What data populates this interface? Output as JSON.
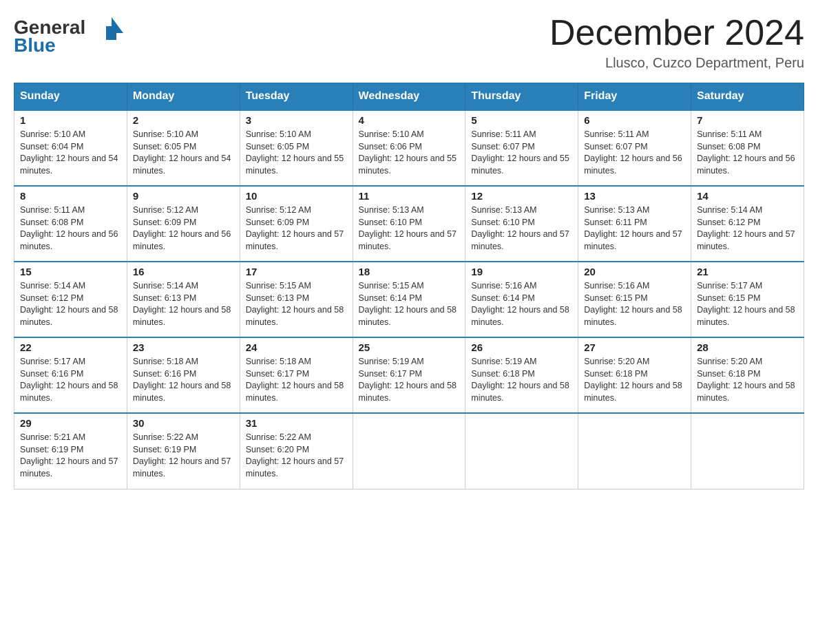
{
  "header": {
    "logo_general": "General",
    "logo_blue": "Blue",
    "title": "December 2024",
    "subtitle": "Llusco, Cuzco Department, Peru"
  },
  "days_of_week": [
    "Sunday",
    "Monday",
    "Tuesday",
    "Wednesday",
    "Thursday",
    "Friday",
    "Saturday"
  ],
  "weeks": [
    [
      {
        "day": "1",
        "sunrise": "5:10 AM",
        "sunset": "6:04 PM",
        "daylight": "12 hours and 54 minutes."
      },
      {
        "day": "2",
        "sunrise": "5:10 AM",
        "sunset": "6:05 PM",
        "daylight": "12 hours and 54 minutes."
      },
      {
        "day": "3",
        "sunrise": "5:10 AM",
        "sunset": "6:05 PM",
        "daylight": "12 hours and 55 minutes."
      },
      {
        "day": "4",
        "sunrise": "5:10 AM",
        "sunset": "6:06 PM",
        "daylight": "12 hours and 55 minutes."
      },
      {
        "day": "5",
        "sunrise": "5:11 AM",
        "sunset": "6:07 PM",
        "daylight": "12 hours and 55 minutes."
      },
      {
        "day": "6",
        "sunrise": "5:11 AM",
        "sunset": "6:07 PM",
        "daylight": "12 hours and 56 minutes."
      },
      {
        "day": "7",
        "sunrise": "5:11 AM",
        "sunset": "6:08 PM",
        "daylight": "12 hours and 56 minutes."
      }
    ],
    [
      {
        "day": "8",
        "sunrise": "5:11 AM",
        "sunset": "6:08 PM",
        "daylight": "12 hours and 56 minutes."
      },
      {
        "day": "9",
        "sunrise": "5:12 AM",
        "sunset": "6:09 PM",
        "daylight": "12 hours and 56 minutes."
      },
      {
        "day": "10",
        "sunrise": "5:12 AM",
        "sunset": "6:09 PM",
        "daylight": "12 hours and 57 minutes."
      },
      {
        "day": "11",
        "sunrise": "5:13 AM",
        "sunset": "6:10 PM",
        "daylight": "12 hours and 57 minutes."
      },
      {
        "day": "12",
        "sunrise": "5:13 AM",
        "sunset": "6:10 PM",
        "daylight": "12 hours and 57 minutes."
      },
      {
        "day": "13",
        "sunrise": "5:13 AM",
        "sunset": "6:11 PM",
        "daylight": "12 hours and 57 minutes."
      },
      {
        "day": "14",
        "sunrise": "5:14 AM",
        "sunset": "6:12 PM",
        "daylight": "12 hours and 57 minutes."
      }
    ],
    [
      {
        "day": "15",
        "sunrise": "5:14 AM",
        "sunset": "6:12 PM",
        "daylight": "12 hours and 58 minutes."
      },
      {
        "day": "16",
        "sunrise": "5:14 AM",
        "sunset": "6:13 PM",
        "daylight": "12 hours and 58 minutes."
      },
      {
        "day": "17",
        "sunrise": "5:15 AM",
        "sunset": "6:13 PM",
        "daylight": "12 hours and 58 minutes."
      },
      {
        "day": "18",
        "sunrise": "5:15 AM",
        "sunset": "6:14 PM",
        "daylight": "12 hours and 58 minutes."
      },
      {
        "day": "19",
        "sunrise": "5:16 AM",
        "sunset": "6:14 PM",
        "daylight": "12 hours and 58 minutes."
      },
      {
        "day": "20",
        "sunrise": "5:16 AM",
        "sunset": "6:15 PM",
        "daylight": "12 hours and 58 minutes."
      },
      {
        "day": "21",
        "sunrise": "5:17 AM",
        "sunset": "6:15 PM",
        "daylight": "12 hours and 58 minutes."
      }
    ],
    [
      {
        "day": "22",
        "sunrise": "5:17 AM",
        "sunset": "6:16 PM",
        "daylight": "12 hours and 58 minutes."
      },
      {
        "day": "23",
        "sunrise": "5:18 AM",
        "sunset": "6:16 PM",
        "daylight": "12 hours and 58 minutes."
      },
      {
        "day": "24",
        "sunrise": "5:18 AM",
        "sunset": "6:17 PM",
        "daylight": "12 hours and 58 minutes."
      },
      {
        "day": "25",
        "sunrise": "5:19 AM",
        "sunset": "6:17 PM",
        "daylight": "12 hours and 58 minutes."
      },
      {
        "day": "26",
        "sunrise": "5:19 AM",
        "sunset": "6:18 PM",
        "daylight": "12 hours and 58 minutes."
      },
      {
        "day": "27",
        "sunrise": "5:20 AM",
        "sunset": "6:18 PM",
        "daylight": "12 hours and 58 minutes."
      },
      {
        "day": "28",
        "sunrise": "5:20 AM",
        "sunset": "6:18 PM",
        "daylight": "12 hours and 58 minutes."
      }
    ],
    [
      {
        "day": "29",
        "sunrise": "5:21 AM",
        "sunset": "6:19 PM",
        "daylight": "12 hours and 57 minutes."
      },
      {
        "day": "30",
        "sunrise": "5:22 AM",
        "sunset": "6:19 PM",
        "daylight": "12 hours and 57 minutes."
      },
      {
        "day": "31",
        "sunrise": "5:22 AM",
        "sunset": "6:20 PM",
        "daylight": "12 hours and 57 minutes."
      },
      null,
      null,
      null,
      null
    ]
  ],
  "colors": {
    "header_bg": "#2980b9",
    "border": "#2980b9",
    "accent_blue": "#1a6fa8"
  }
}
